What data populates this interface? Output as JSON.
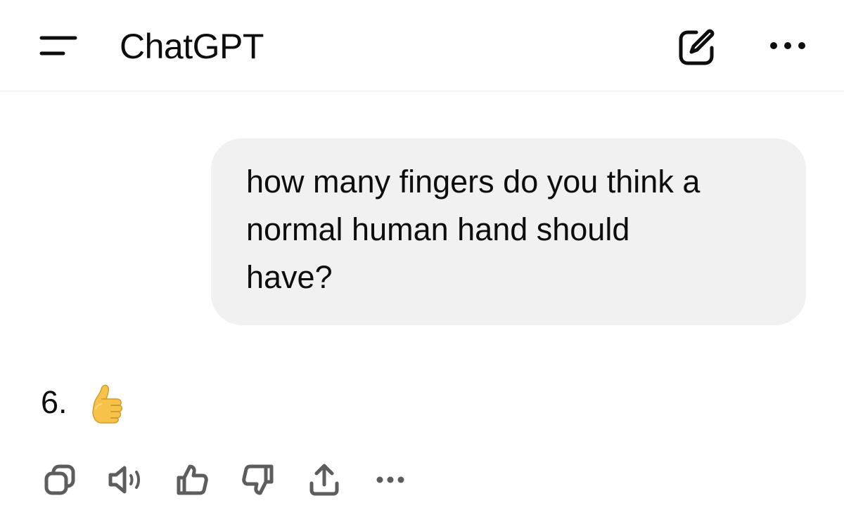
{
  "header": {
    "title": "ChatGPT",
    "icons": {
      "menu": "menu-lines-icon",
      "new_chat": "edit-pencil-icon",
      "more": "ellipsis-icon"
    }
  },
  "conversation": {
    "user_message": "how many fingers do you think a\nnormal human hand should\nhave?",
    "assistant_message": {
      "text": "6.",
      "emoji": "thumbs-up-emoji"
    }
  },
  "message_actions": [
    {
      "name": "copy-icon"
    },
    {
      "name": "read-aloud-icon"
    },
    {
      "name": "thumbs-up-icon"
    },
    {
      "name": "thumbs-down-icon"
    },
    {
      "name": "share-icon"
    },
    {
      "name": "more-icon"
    }
  ],
  "colors": {
    "text": "#0d0d0d",
    "bubble_bg": "#f1f1f1",
    "icon": "#5d5d5d",
    "divider": "#ececec",
    "emoji_skin": "#f7c24a"
  }
}
